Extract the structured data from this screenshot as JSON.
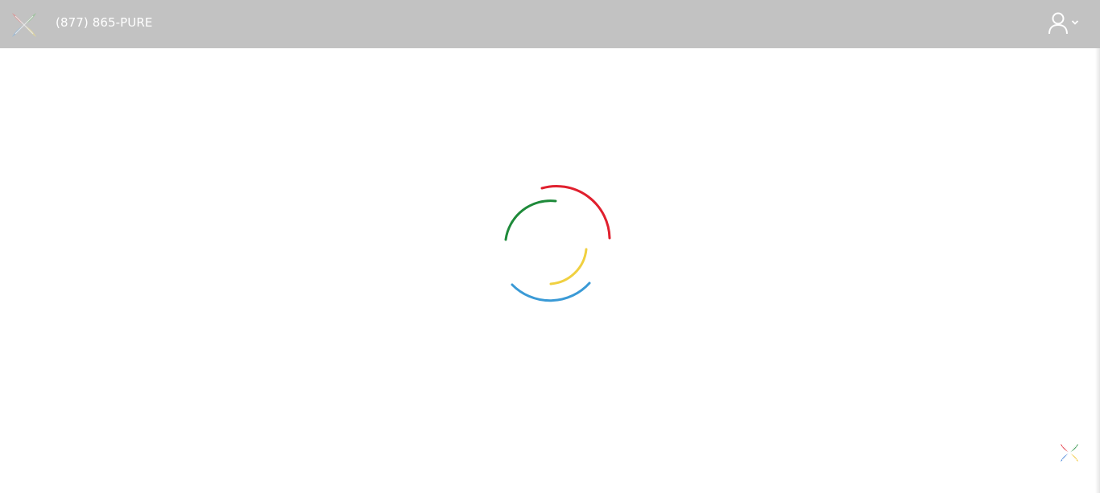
{
  "header": {
    "phone": "(877) 865-PURE",
    "background_color": "#c2c2c2",
    "logo_icon": "brand-x-logo-icon",
    "user_icon": "user-icon",
    "menu_icon": "chevron-down-icon"
  },
  "loading": {
    "icon": "loading-spinner-icon",
    "colors": [
      "#e0202e",
      "#1e8a3a",
      "#f0d040",
      "#3a9ad6"
    ]
  },
  "corner": {
    "icon": "brand-x-logo-icon"
  }
}
